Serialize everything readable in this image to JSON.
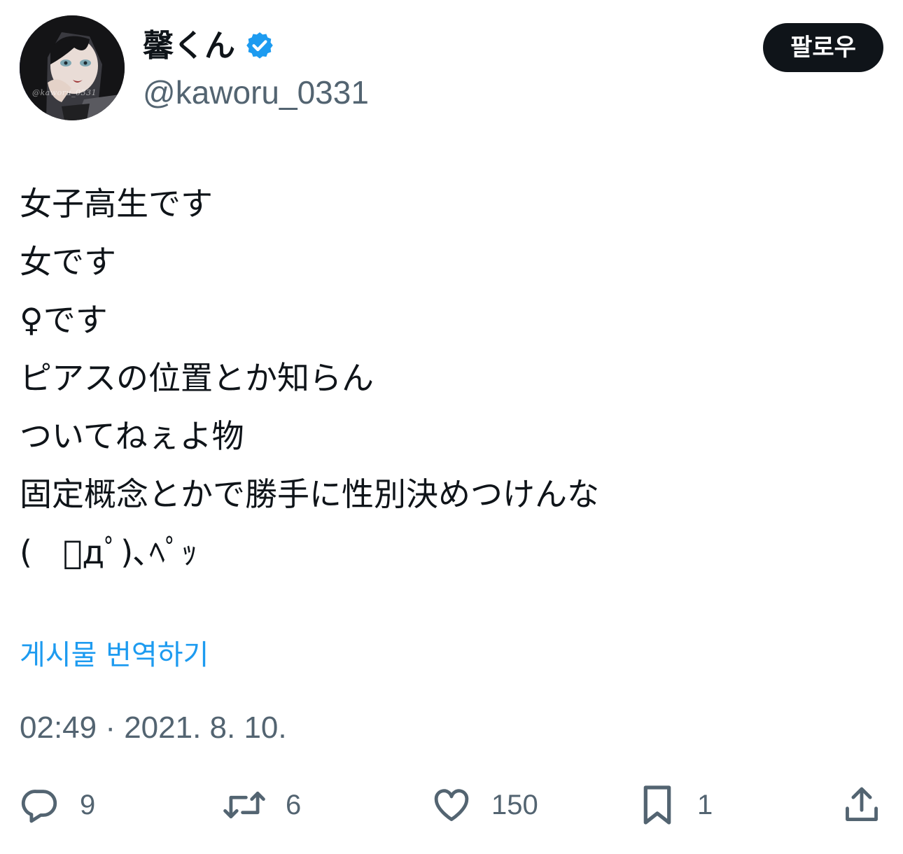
{
  "author": {
    "display_name": "馨くん",
    "handle": "@kaworu_0331",
    "avatar_watermark": "@kaworu_0331",
    "verified_color": "#1d9bf0"
  },
  "header": {
    "follow_label": "팔로우"
  },
  "tweet": {
    "lines": [
      "女子高生です",
      "女です",
      "♀です",
      "ピアスの位置とか知らん",
      "ついてねぇよ物",
      "固定概念とかで勝手に性別決めつけんな",
      "(   ﾟдﾟ)､ﾍﾟｯ"
    ],
    "translate_label": "게시물 번역하기",
    "timestamp": "02:49 · 2021. 8. 10."
  },
  "actions": {
    "reply": {
      "icon": "reply-icon",
      "count": "9"
    },
    "retweet": {
      "icon": "retweet-icon",
      "count": "6"
    },
    "like": {
      "icon": "heart-icon",
      "count": "150"
    },
    "bookmark": {
      "icon": "bookmark-icon",
      "count": "1"
    },
    "share": {
      "icon": "share-icon"
    }
  },
  "colors": {
    "text": "#0f1419",
    "secondary": "#536471",
    "link": "#1d9bf0",
    "button_bg": "#0f1419"
  }
}
